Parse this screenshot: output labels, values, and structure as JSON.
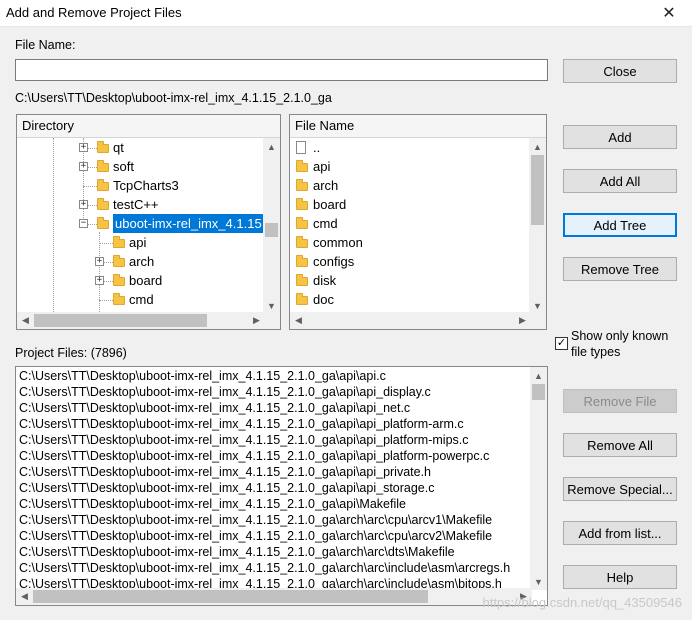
{
  "window": {
    "title": "Add and Remove Project Files"
  },
  "file_name": {
    "label": "File Name:",
    "value": ""
  },
  "current_path": "C:\\Users\\TT\\Desktop\\uboot-imx-rel_imx_4.1.15_2.1.0_ga",
  "directory_panel": {
    "header": "Directory",
    "items": [
      {
        "label": "qt",
        "expander": "+"
      },
      {
        "label": "soft",
        "expander": "+"
      },
      {
        "label": "TcpCharts3",
        "expander": ""
      },
      {
        "label": "testC++",
        "expander": "+"
      },
      {
        "label": "uboot-imx-rel_imx_4.1.15",
        "expander": "-"
      },
      {
        "label": "api",
        "expander": ""
      },
      {
        "label": "arch",
        "expander": "+"
      },
      {
        "label": "board",
        "expander": "+"
      },
      {
        "label": "cmd",
        "expander": ""
      }
    ]
  },
  "file_panel": {
    "header": "File Name",
    "items": [
      {
        "label": "..",
        "icon": "file-icon"
      },
      {
        "label": "api",
        "icon": "folder-icon"
      },
      {
        "label": "arch",
        "icon": "folder-icon"
      },
      {
        "label": "board",
        "icon": "folder-icon"
      },
      {
        "label": "cmd",
        "icon": "folder-icon"
      },
      {
        "label": "common",
        "icon": "folder-icon"
      },
      {
        "label": "configs",
        "icon": "folder-icon"
      },
      {
        "label": "disk",
        "icon": "folder-icon"
      },
      {
        "label": "doc",
        "icon": "folder-icon"
      }
    ]
  },
  "buttons": {
    "close": "Close",
    "add": "Add",
    "add_all": "Add All",
    "add_tree": "Add Tree",
    "remove_tree": "Remove Tree",
    "remove_file": "Remove File",
    "remove_all": "Remove All",
    "remove_special": "Remove Special...",
    "add_from_list": "Add from list...",
    "help": "Help"
  },
  "show_only_known": {
    "label_line1": "Show only known",
    "label_line2": "file types",
    "checked": true,
    "mark": "✓"
  },
  "project_files": {
    "label": "Project Files: (7896)",
    "items": [
      "C:\\Users\\TT\\Desktop\\uboot-imx-rel_imx_4.1.15_2.1.0_ga\\api\\api.c",
      "C:\\Users\\TT\\Desktop\\uboot-imx-rel_imx_4.1.15_2.1.0_ga\\api\\api_display.c",
      "C:\\Users\\TT\\Desktop\\uboot-imx-rel_imx_4.1.15_2.1.0_ga\\api\\api_net.c",
      "C:\\Users\\TT\\Desktop\\uboot-imx-rel_imx_4.1.15_2.1.0_ga\\api\\api_platform-arm.c",
      "C:\\Users\\TT\\Desktop\\uboot-imx-rel_imx_4.1.15_2.1.0_ga\\api\\api_platform-mips.c",
      "C:\\Users\\TT\\Desktop\\uboot-imx-rel_imx_4.1.15_2.1.0_ga\\api\\api_platform-powerpc.c",
      "C:\\Users\\TT\\Desktop\\uboot-imx-rel_imx_4.1.15_2.1.0_ga\\api\\api_private.h",
      "C:\\Users\\TT\\Desktop\\uboot-imx-rel_imx_4.1.15_2.1.0_ga\\api\\api_storage.c",
      "C:\\Users\\TT\\Desktop\\uboot-imx-rel_imx_4.1.15_2.1.0_ga\\api\\Makefile",
      "C:\\Users\\TT\\Desktop\\uboot-imx-rel_imx_4.1.15_2.1.0_ga\\arch\\arc\\cpu\\arcv1\\Makefile",
      "C:\\Users\\TT\\Desktop\\uboot-imx-rel_imx_4.1.15_2.1.0_ga\\arch\\arc\\cpu\\arcv2\\Makefile",
      "C:\\Users\\TT\\Desktop\\uboot-imx-rel_imx_4.1.15_2.1.0_ga\\arch\\arc\\dts\\Makefile",
      "C:\\Users\\TT\\Desktop\\uboot-imx-rel_imx_4.1.15_2.1.0_ga\\arch\\arc\\include\\asm\\arcregs.h",
      "C:\\Users\\TT\\Desktop\\uboot-imx-rel_imx_4.1.15_2.1.0_ga\\arch\\arc\\include\\asm\\bitops.h"
    ]
  },
  "watermark": "https://blog.csdn.net/qq_43509546"
}
